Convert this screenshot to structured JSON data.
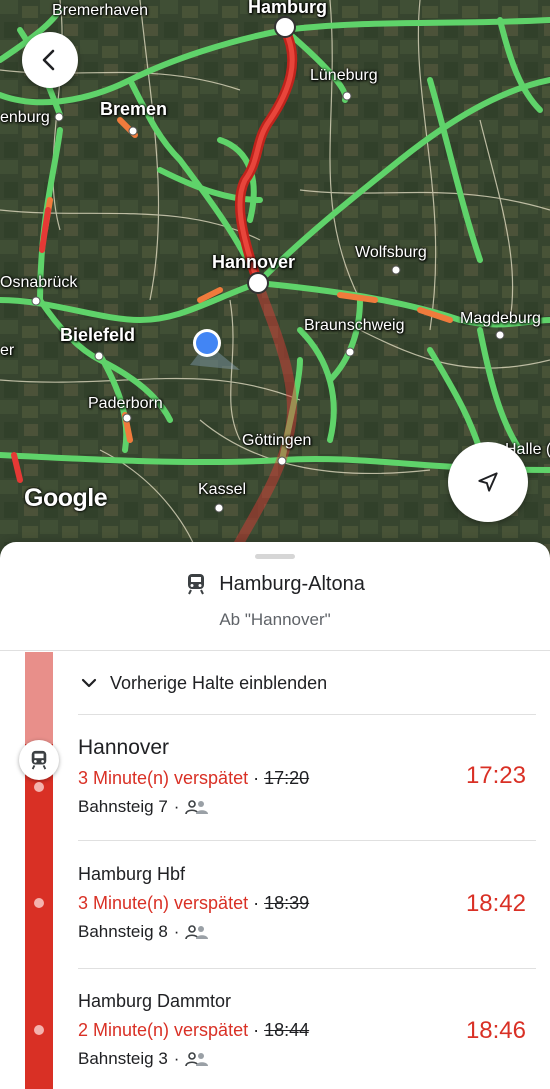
{
  "map": {
    "cities": [
      {
        "name": "Bremerhaven"
      },
      {
        "name": "Hamburg"
      },
      {
        "name": "Lüneburg"
      },
      {
        "name": "Bremen"
      },
      {
        "name": "enburg"
      },
      {
        "name": "haven"
      },
      {
        "name": "Hannover"
      },
      {
        "name": "Wolfsburg"
      },
      {
        "name": "Osnabrück"
      },
      {
        "name": "Bielefeld"
      },
      {
        "name": "Braunschweig"
      },
      {
        "name": "Magdeburg"
      },
      {
        "name": "er"
      },
      {
        "name": "Paderborn"
      },
      {
        "name": "Göttingen"
      },
      {
        "name": "Halle ("
      },
      {
        "name": "Kassel"
      }
    ],
    "attribution": "Google",
    "back_icon": "chevron-left-icon",
    "locate_icon": "navigation-arrow-icon"
  },
  "trip": {
    "title": "Hamburg-Altona",
    "subtitle": "Ab \"Hannover\"",
    "train_icon": "train-icon",
    "toggle_label": "Vorherige Halte einblenden",
    "line_color": "#d93025",
    "stops": [
      {
        "name": "Hannover",
        "delay": "3 Minute(n) verspätet",
        "scheduled": "17:20",
        "actual": "17:23",
        "platform": "Bahnsteig 7",
        "current": true
      },
      {
        "name": "Hamburg Hbf",
        "delay": "3 Minute(n) verspätet",
        "scheduled": "18:39",
        "actual": "18:42",
        "platform": "Bahnsteig 8",
        "current": false
      },
      {
        "name": "Hamburg Dammtor",
        "delay": "2 Minute(n) verspätet",
        "scheduled": "18:44",
        "actual": "18:46",
        "platform": "Bahnsteig 3",
        "current": false
      }
    ],
    "separator": "·"
  }
}
